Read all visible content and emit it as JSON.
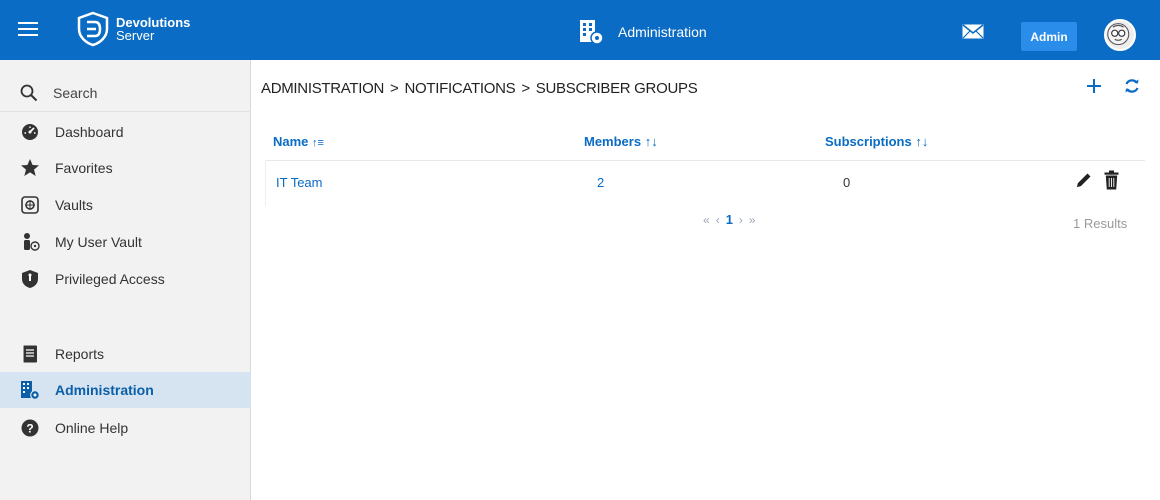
{
  "header": {
    "brand_line1": "Devolutions",
    "brand_line2": "Server",
    "title": "Administration",
    "admin_label": "Admin",
    "icons": [
      "menu-icon",
      "devolutions-shield-icon",
      "administration-building-icon",
      "mail-icon",
      "user-avatar"
    ]
  },
  "sidebar": {
    "search_label": "Search",
    "items": [
      {
        "label": "Dashboard",
        "icon": "dashboard-icon"
      },
      {
        "label": "Favorites",
        "icon": "star-icon"
      },
      {
        "label": "Vaults",
        "icon": "vault-icon"
      },
      {
        "label": "My User Vault",
        "icon": "user-vault-icon"
      },
      {
        "label": "Privileged Access",
        "icon": "shield-icon"
      },
      {
        "label": "Reports",
        "icon": "reports-icon"
      },
      {
        "label": "Administration",
        "icon": "administration-icon",
        "active": true
      },
      {
        "label": "Online Help",
        "icon": "help-icon"
      }
    ]
  },
  "breadcrumb": {
    "parts": [
      "ADMINISTRATION",
      "NOTIFICATIONS",
      "SUBSCRIBER GROUPS"
    ],
    "separator": ">"
  },
  "table": {
    "columns": [
      {
        "label": "Name",
        "sort_icon": "sort-asc-icon",
        "sort_glyph": "↑≡"
      },
      {
        "label": "Members",
        "sort_icon": "sort-both-icon",
        "sort_glyph": "↑↓"
      },
      {
        "label": "Subscriptions",
        "sort_icon": "sort-both-icon",
        "sort_glyph": "↑↓"
      }
    ],
    "rows": [
      {
        "name": "IT Team",
        "members": "2",
        "subscriptions": "0"
      }
    ]
  },
  "pager": {
    "first": "«",
    "prev": "‹",
    "current": "1",
    "next": "›",
    "last": "»"
  },
  "results_text": "1 Results",
  "colors": {
    "topbar": "#0a6cc4",
    "accent": "#0a6cc4",
    "admin_button": "#2a8dea",
    "sidebar_bg": "#f2f2f2",
    "active_bg": "#d6e4f1"
  }
}
